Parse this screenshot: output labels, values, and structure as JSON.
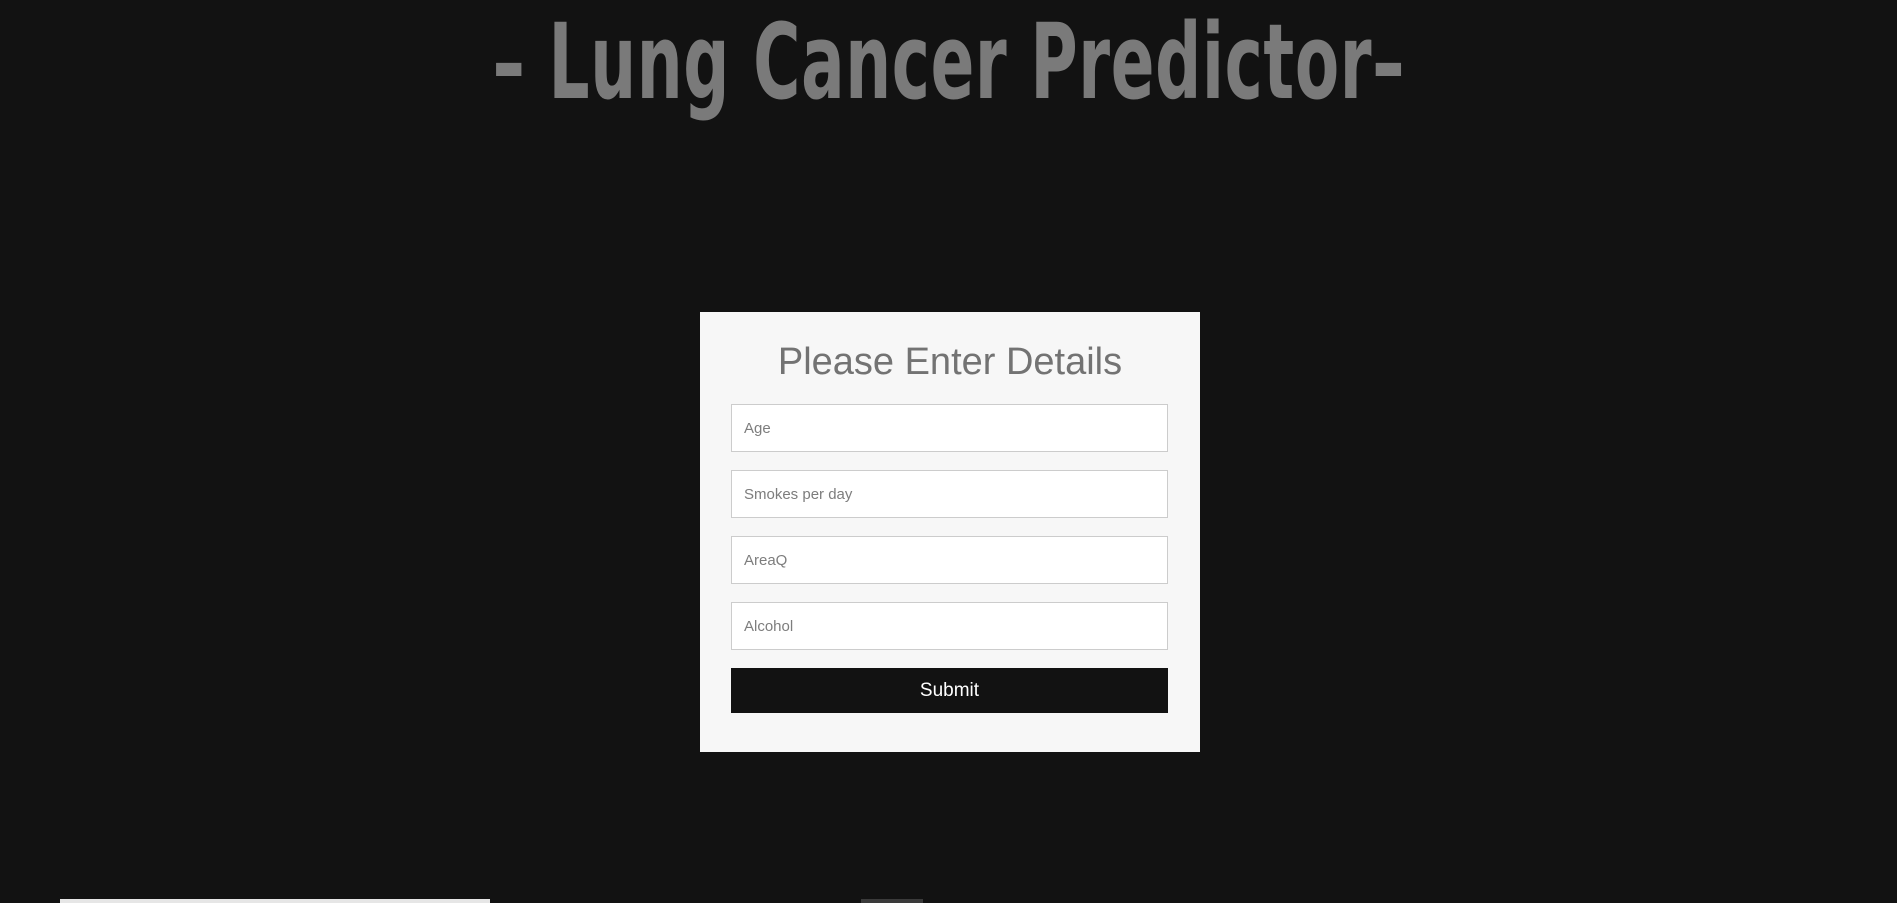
{
  "header": {
    "title": "– Lung Cancer Predictor–"
  },
  "form": {
    "heading": "Please Enter Details",
    "fields": [
      {
        "placeholder": "Age",
        "value": ""
      },
      {
        "placeholder": "Smokes per day",
        "value": ""
      },
      {
        "placeholder": "AreaQ",
        "value": ""
      },
      {
        "placeholder": "Alcohol",
        "value": ""
      }
    ],
    "submit_label": "Submit"
  },
  "colors": {
    "background": "#121212",
    "card": "#f7f7f7",
    "title_text": "#7a7a7a",
    "heading_text": "#737373",
    "button": "#121212",
    "button_text": "#ffffff"
  }
}
